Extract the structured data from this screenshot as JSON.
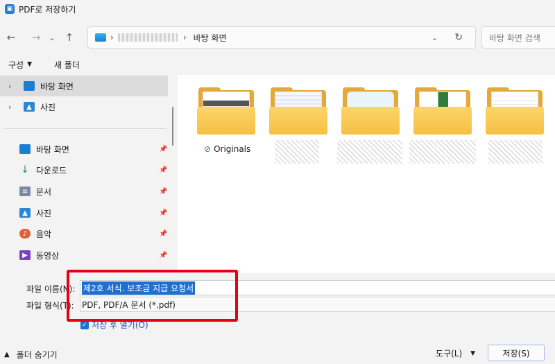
{
  "window": {
    "title": "PDF로 저장하기"
  },
  "nav": {
    "back": "←",
    "forward": "→",
    "recent": "⌄",
    "up": "↑"
  },
  "address": {
    "separator": "›",
    "crumb": "바탕 화면",
    "dropdown": "⌄",
    "refresh": "↻"
  },
  "search": {
    "placeholder": "바탕 화면 검색"
  },
  "toolbar": {
    "organize": "구성",
    "new_folder": "새 폴더"
  },
  "sidebar": {
    "tree": [
      {
        "label": "바탕 화면",
        "icon": "desktop-icon",
        "color": "#1a7fd2",
        "selected": true
      },
      {
        "label": "사진",
        "icon": "pictures-icon",
        "color": "#2a86d6",
        "selected": false
      }
    ],
    "quick_access": [
      {
        "label": "바탕 화면",
        "icon": "desktop-icon",
        "color": "#1a7fd2",
        "glyph": ""
      },
      {
        "label": "다운로드",
        "icon": "download-icon",
        "color": "#1b8f5a",
        "glyph": "↓"
      },
      {
        "label": "문서",
        "icon": "documents-icon",
        "color": "#7a8aa0",
        "glyph": "≡"
      },
      {
        "label": "사진",
        "icon": "pictures-icon",
        "color": "#2a86d6",
        "glyph": "▲"
      },
      {
        "label": "음악",
        "icon": "music-icon",
        "color": "#e0603a",
        "glyph": "♪"
      },
      {
        "label": "동영상",
        "icon": "videos-icon",
        "color": "#7a3fc6",
        "glyph": "▶"
      }
    ],
    "pin": "📌"
  },
  "folders": [
    {
      "label": "Originals",
      "synced": true,
      "check": "⊘"
    },
    {
      "label": "",
      "synced": false
    },
    {
      "label": "",
      "synced": false
    },
    {
      "label": "",
      "synced": false
    },
    {
      "label": "",
      "synced": false
    }
  ],
  "form": {
    "filename_label": "파일 이름(N):",
    "filename_value": "제2호 서식. 보조금 지급 요청서",
    "filetype_label": "파일 형식(T):",
    "filetype_value": "PDF, PDF/A 문서 (*.pdf)",
    "open_after_label": "저장 후 열기(O)",
    "open_after_checked": true
  },
  "footer": {
    "hide_folders": "폴더 숨기기",
    "tools": "도구(L)",
    "save": "저장(S)"
  },
  "colors": {
    "accent": "#1f6fd1",
    "highlight_box": "#e60012",
    "folder": "#f6c042"
  }
}
